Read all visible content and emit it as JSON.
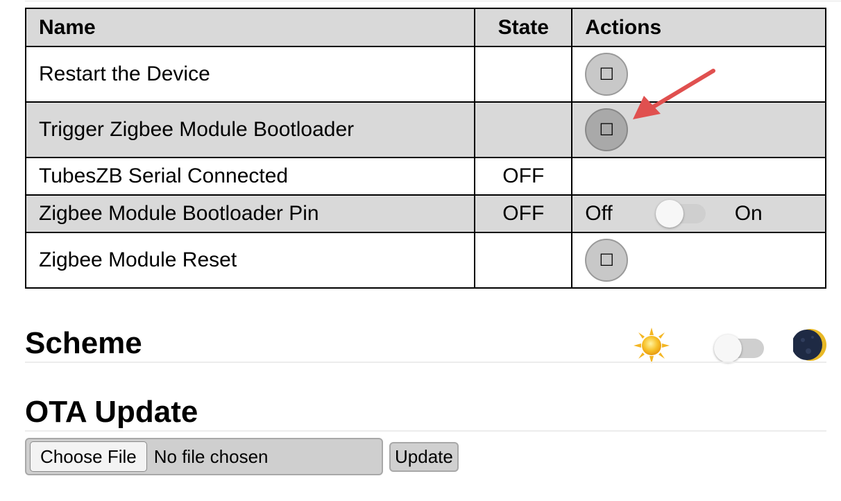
{
  "table": {
    "headers": {
      "name": "Name",
      "state": "State",
      "actions": "Actions"
    },
    "rows": [
      {
        "name": "Restart the Device",
        "state": "",
        "action": "button",
        "button_glyph": "☐"
      },
      {
        "name": "Trigger Zigbee Module Bootloader",
        "state": "",
        "action": "button",
        "button_glyph": "☐"
      },
      {
        "name": "TubesZB Serial Connected",
        "state": "OFF",
        "action": "none"
      },
      {
        "name": "Zigbee Module Bootloader Pin",
        "state": "OFF",
        "action": "switch",
        "switch_off_label": "Off",
        "switch_on_label": "On",
        "switch_on": false
      },
      {
        "name": "Zigbee Module Reset",
        "state": "",
        "action": "button",
        "button_glyph": "☐"
      }
    ]
  },
  "annotation": {
    "icon": "red-arrow-icon",
    "color": "#e0504f"
  },
  "scheme": {
    "title": "Scheme",
    "light_icon": "sun-icon",
    "dark_icon": "moon-icon",
    "dark_mode": false
  },
  "ota": {
    "title": "OTA Update",
    "choose_label": "Choose File",
    "file_status": "No file chosen",
    "update_label": "Update"
  },
  "colors": {
    "header_bg": "#d9d9d9",
    "shaded_row_bg": "#d9d9d9",
    "button_bg": "#c8c8c8",
    "toggle_track": "#cfcfcf"
  }
}
